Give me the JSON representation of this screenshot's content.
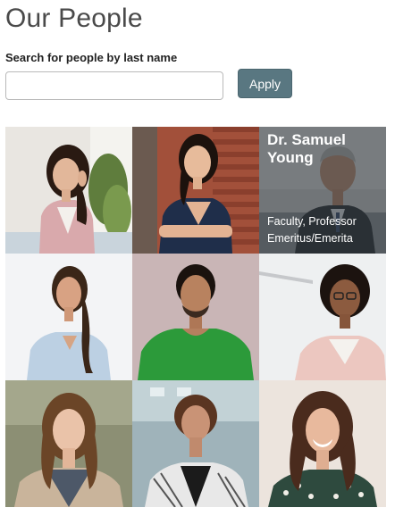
{
  "page": {
    "title": "Our People"
  },
  "search": {
    "label": "Search for people by last name",
    "value": "",
    "placeholder": "",
    "apply_label": "Apply"
  },
  "people": [
    {
      "name": "",
      "role": "",
      "hovered": false
    },
    {
      "name": "",
      "role": "",
      "hovered": false
    },
    {
      "name": "Dr. Samuel Young",
      "role_line1": "Faculty, Professor",
      "role_line2": "Emeritus/Emerita",
      "hovered": true
    },
    {
      "name": "",
      "role": "",
      "hovered": false
    },
    {
      "name": "",
      "role": "",
      "hovered": false
    },
    {
      "name": "",
      "role": "",
      "hovered": false
    },
    {
      "name": "",
      "role": "",
      "hovered": false
    },
    {
      "name": "",
      "role": "",
      "hovered": false
    },
    {
      "name": "",
      "role": "",
      "hovered": false
    }
  ],
  "colors": {
    "apply_button": "#597781",
    "overlay": "#1e2226"
  }
}
